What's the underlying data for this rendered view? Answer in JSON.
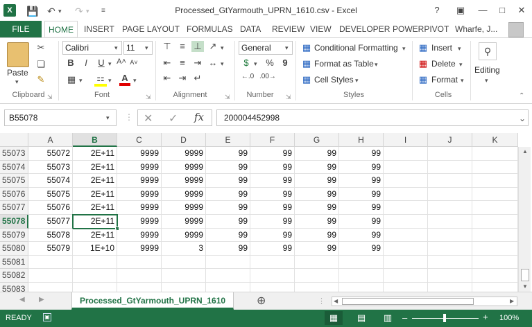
{
  "app": {
    "title": "Processed_GtYarmouth_UPRN_1610.csv - Excel",
    "logo": "X",
    "qat_icons": [
      "save-icon",
      "undo-icon",
      "redo-icon",
      "customize-qat-icon"
    ],
    "window_controls": [
      "?",
      "restore-icon",
      "minimize-icon",
      "maximize-icon",
      "close-icon"
    ]
  },
  "tabs": {
    "file": "FILE",
    "items": [
      "HOME",
      "INSERT",
      "PAGE LAYOUT",
      "FORMULAS",
      "DATA",
      "REVIEW",
      "VIEW",
      "DEVELOPER",
      "POWERPIVOT"
    ],
    "active": "HOME",
    "user": "Wharfe, J..."
  },
  "ribbon": {
    "clipboard": {
      "paste": "Paste",
      "label": "Clipboard"
    },
    "font": {
      "name": "Calibri",
      "size": "11",
      "label": "Font",
      "bold": "B",
      "italic": "I",
      "underline": "U"
    },
    "alignment": {
      "label": "Alignment"
    },
    "number": {
      "format": "General",
      "label": "Number",
      "percent": "%",
      "comma": "9"
    },
    "styles": {
      "conditional": "Conditional Formatting",
      "format_table": "Format as Table",
      "cell_styles": "Cell Styles",
      "label": "Styles"
    },
    "cells": {
      "insert": "Insert",
      "delete": "Delete",
      "format": "Format",
      "label": "Cells"
    },
    "editing": {
      "label": "Editing"
    }
  },
  "formula_bar": {
    "name_box": "B55078",
    "cancel": "✕",
    "enter": "✓",
    "fx": "fx",
    "value": "200004452998"
  },
  "grid": {
    "columns": [
      "A",
      "B",
      "C",
      "D",
      "E",
      "F",
      "G",
      "H",
      "I",
      "J",
      "K"
    ],
    "selected_column": "B",
    "selected_row": "55078",
    "rows": [
      {
        "num": "55073",
        "cells": [
          "55072",
          "2E+11",
          "9999",
          "9999",
          "99",
          "99",
          "99",
          "99"
        ]
      },
      {
        "num": "55074",
        "cells": [
          "55073",
          "2E+11",
          "9999",
          "9999",
          "99",
          "99",
          "99",
          "99"
        ]
      },
      {
        "num": "55075",
        "cells": [
          "55074",
          "2E+11",
          "9999",
          "9999",
          "99",
          "99",
          "99",
          "99"
        ]
      },
      {
        "num": "55076",
        "cells": [
          "55075",
          "2E+11",
          "9999",
          "9999",
          "99",
          "99",
          "99",
          "99"
        ]
      },
      {
        "num": "55077",
        "cells": [
          "55076",
          "2E+11",
          "9999",
          "9999",
          "99",
          "99",
          "99",
          "99"
        ]
      },
      {
        "num": "55078",
        "cells": [
          "55077",
          "2E+11",
          "9999",
          "9999",
          "99",
          "99",
          "99",
          "99"
        ]
      },
      {
        "num": "55079",
        "cells": [
          "55078",
          "2E+11",
          "9999",
          "9999",
          "99",
          "99",
          "99",
          "99"
        ]
      },
      {
        "num": "55080",
        "cells": [
          "55079",
          "1E+10",
          "9999",
          "3",
          "99",
          "99",
          "99",
          "99"
        ]
      },
      {
        "num": "55081",
        "cells": [
          "",
          "",
          "",
          "",
          "",
          "",
          "",
          ""
        ]
      },
      {
        "num": "55082",
        "cells": [
          "",
          "",
          "",
          "",
          "",
          "",
          "",
          ""
        ]
      },
      {
        "num": "55083",
        "cells": [
          "",
          "",
          "",
          "",
          "",
          "",
          "",
          ""
        ]
      }
    ]
  },
  "sheets": {
    "active": "Processed_GtYarmouth_UPRN_1610",
    "add": "⊕"
  },
  "status": {
    "ready": "READY",
    "zoom": "100%"
  },
  "colors": {
    "accent": "#217346"
  }
}
